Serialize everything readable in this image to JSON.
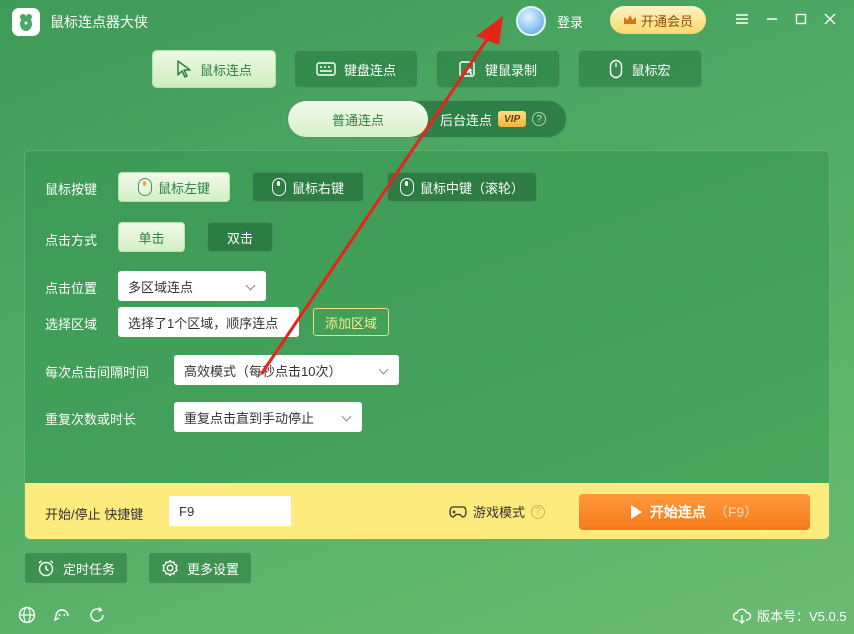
{
  "app": {
    "title": "鼠标连点器大侠"
  },
  "header": {
    "login": "登录",
    "vip": "开通会员"
  },
  "tabs": [
    {
      "label": "鼠标连点",
      "icon": "cursor-icon",
      "active": true
    },
    {
      "label": "键盘连点",
      "icon": "keyboard-icon",
      "active": false
    },
    {
      "label": "键鼠录制",
      "icon": "record-icon",
      "active": false
    },
    {
      "label": "鼠标宏",
      "icon": "mouse-icon",
      "active": false
    }
  ],
  "mode": {
    "normal": "普通连点",
    "background": "后台连点",
    "vip_tag": "VIP"
  },
  "settings": {
    "mouse_button": {
      "label": "鼠标按键",
      "options": [
        "鼠标左键",
        "鼠标右键",
        "鼠标中键（滚轮）"
      ],
      "selected": "鼠标左键"
    },
    "click_method": {
      "label": "点击方式",
      "options": [
        "单击",
        "双击"
      ],
      "selected": "单击"
    },
    "click_position": {
      "label": "点击位置",
      "value": "多区域连点"
    },
    "select_area": {
      "label": "选择区域",
      "value": "选择了1个区域，顺序连点",
      "add_button": "添加区域"
    },
    "interval": {
      "label": "每次点击间隔时间",
      "value": "高效模式（每秒点击10次）"
    },
    "repeat": {
      "label": "重复次数或时长",
      "value": "重复点击直到手动停止"
    }
  },
  "bottom": {
    "shortcut_label": "开始/停止 快捷键",
    "shortcut_value": "F9",
    "game_mode": "游戏模式",
    "start_label": "开始连点",
    "start_hotkey": "（F9）"
  },
  "footer": {
    "timer_task": "定时任务",
    "more_settings": "更多设置",
    "version": "版本号：V5.0.5"
  },
  "colors": {
    "accent_green": "#3f9a58",
    "start_orange": "#f57a19",
    "bar_yellow": "#fdeb7e",
    "annotation_red": "#e8231a"
  }
}
